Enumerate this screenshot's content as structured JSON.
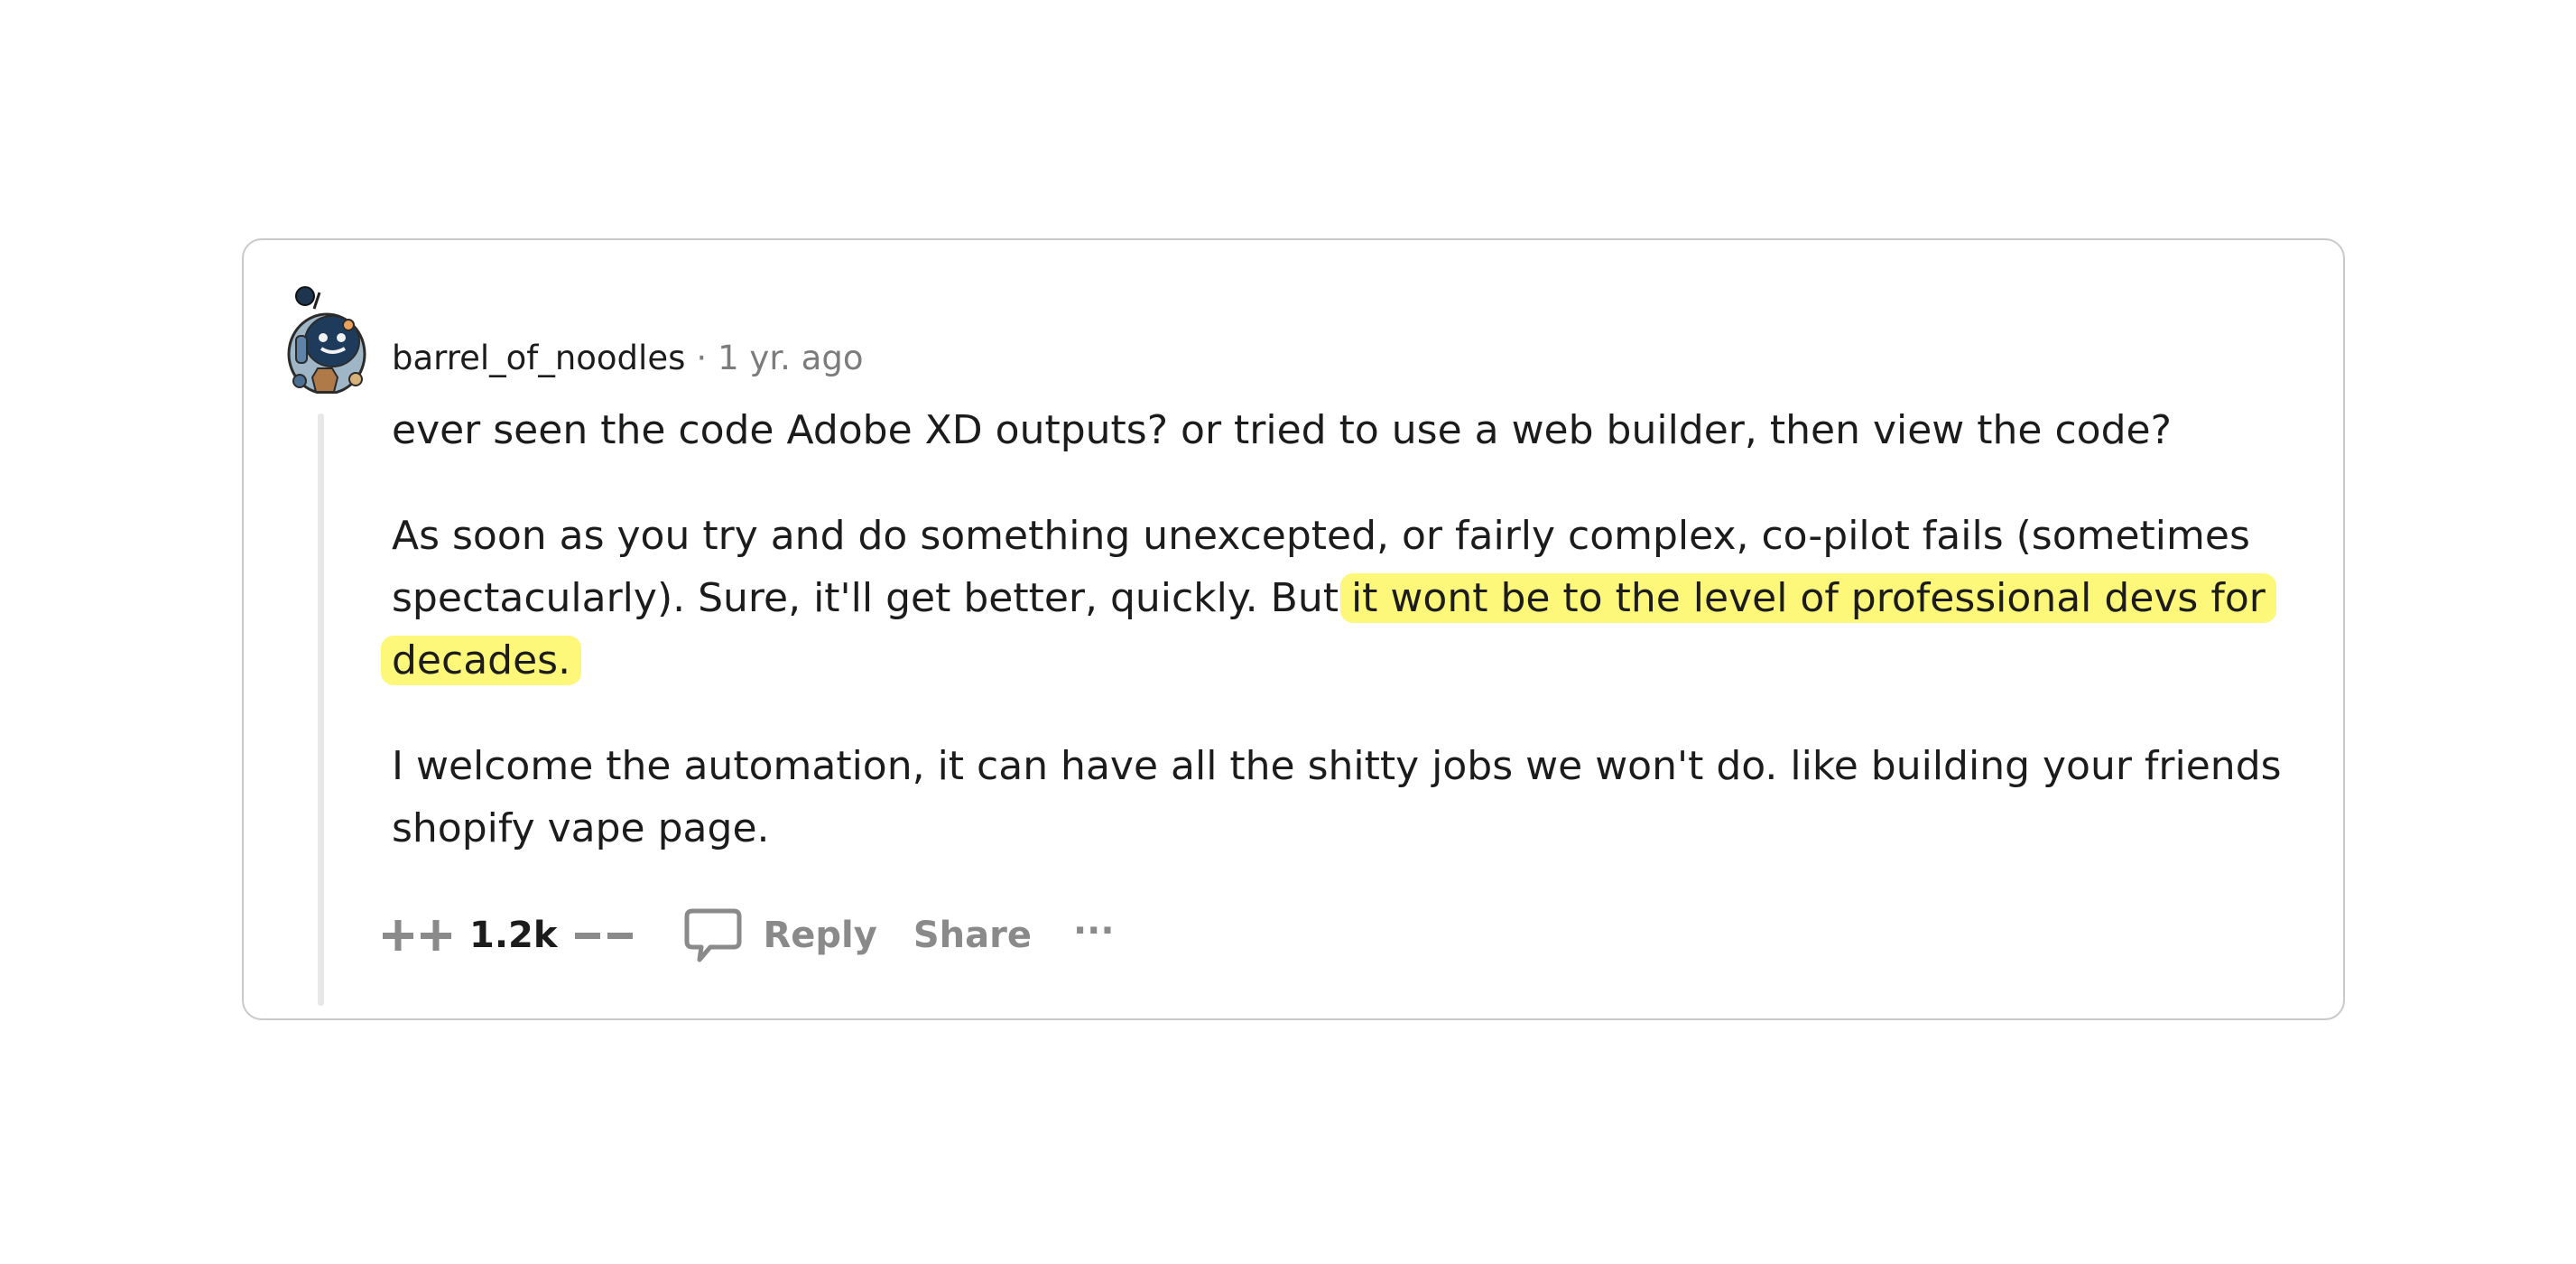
{
  "comment": {
    "username": "barrel_of_noodles",
    "separator": "·",
    "timestamp": "1 yr. ago",
    "paragraphs": {
      "p1": "ever seen the code Adobe XD outputs? or tried to use a web builder, then view the code?",
      "p2_line1": "As soon as you try and do something unexcepted, or fairly complex, co-pilot fails (sometimes",
      "p2_line2_plain": "spectacularly). Sure, it'll get better, quickly. But ",
      "p2_line2_highlight": "it wont be to the level of professional devs for",
      "p2_line3_highlight": "decades.",
      "p3_line1": "I welcome the automation, it can have all the shitty jobs we won't do. like building your friends",
      "p3_line2": "shopify vape page."
    },
    "highlight_color": "#fdf77a",
    "actions": {
      "vote_count": "1.2k",
      "reply_label": "Reply",
      "share_label": "Share",
      "more_label": "···"
    },
    "icons": {
      "avatar": "snoo-avatar",
      "upvote": "upvote-icon",
      "downvote": "downvote-icon",
      "reply": "speech-bubble-icon",
      "more": "ellipsis-icon"
    }
  }
}
